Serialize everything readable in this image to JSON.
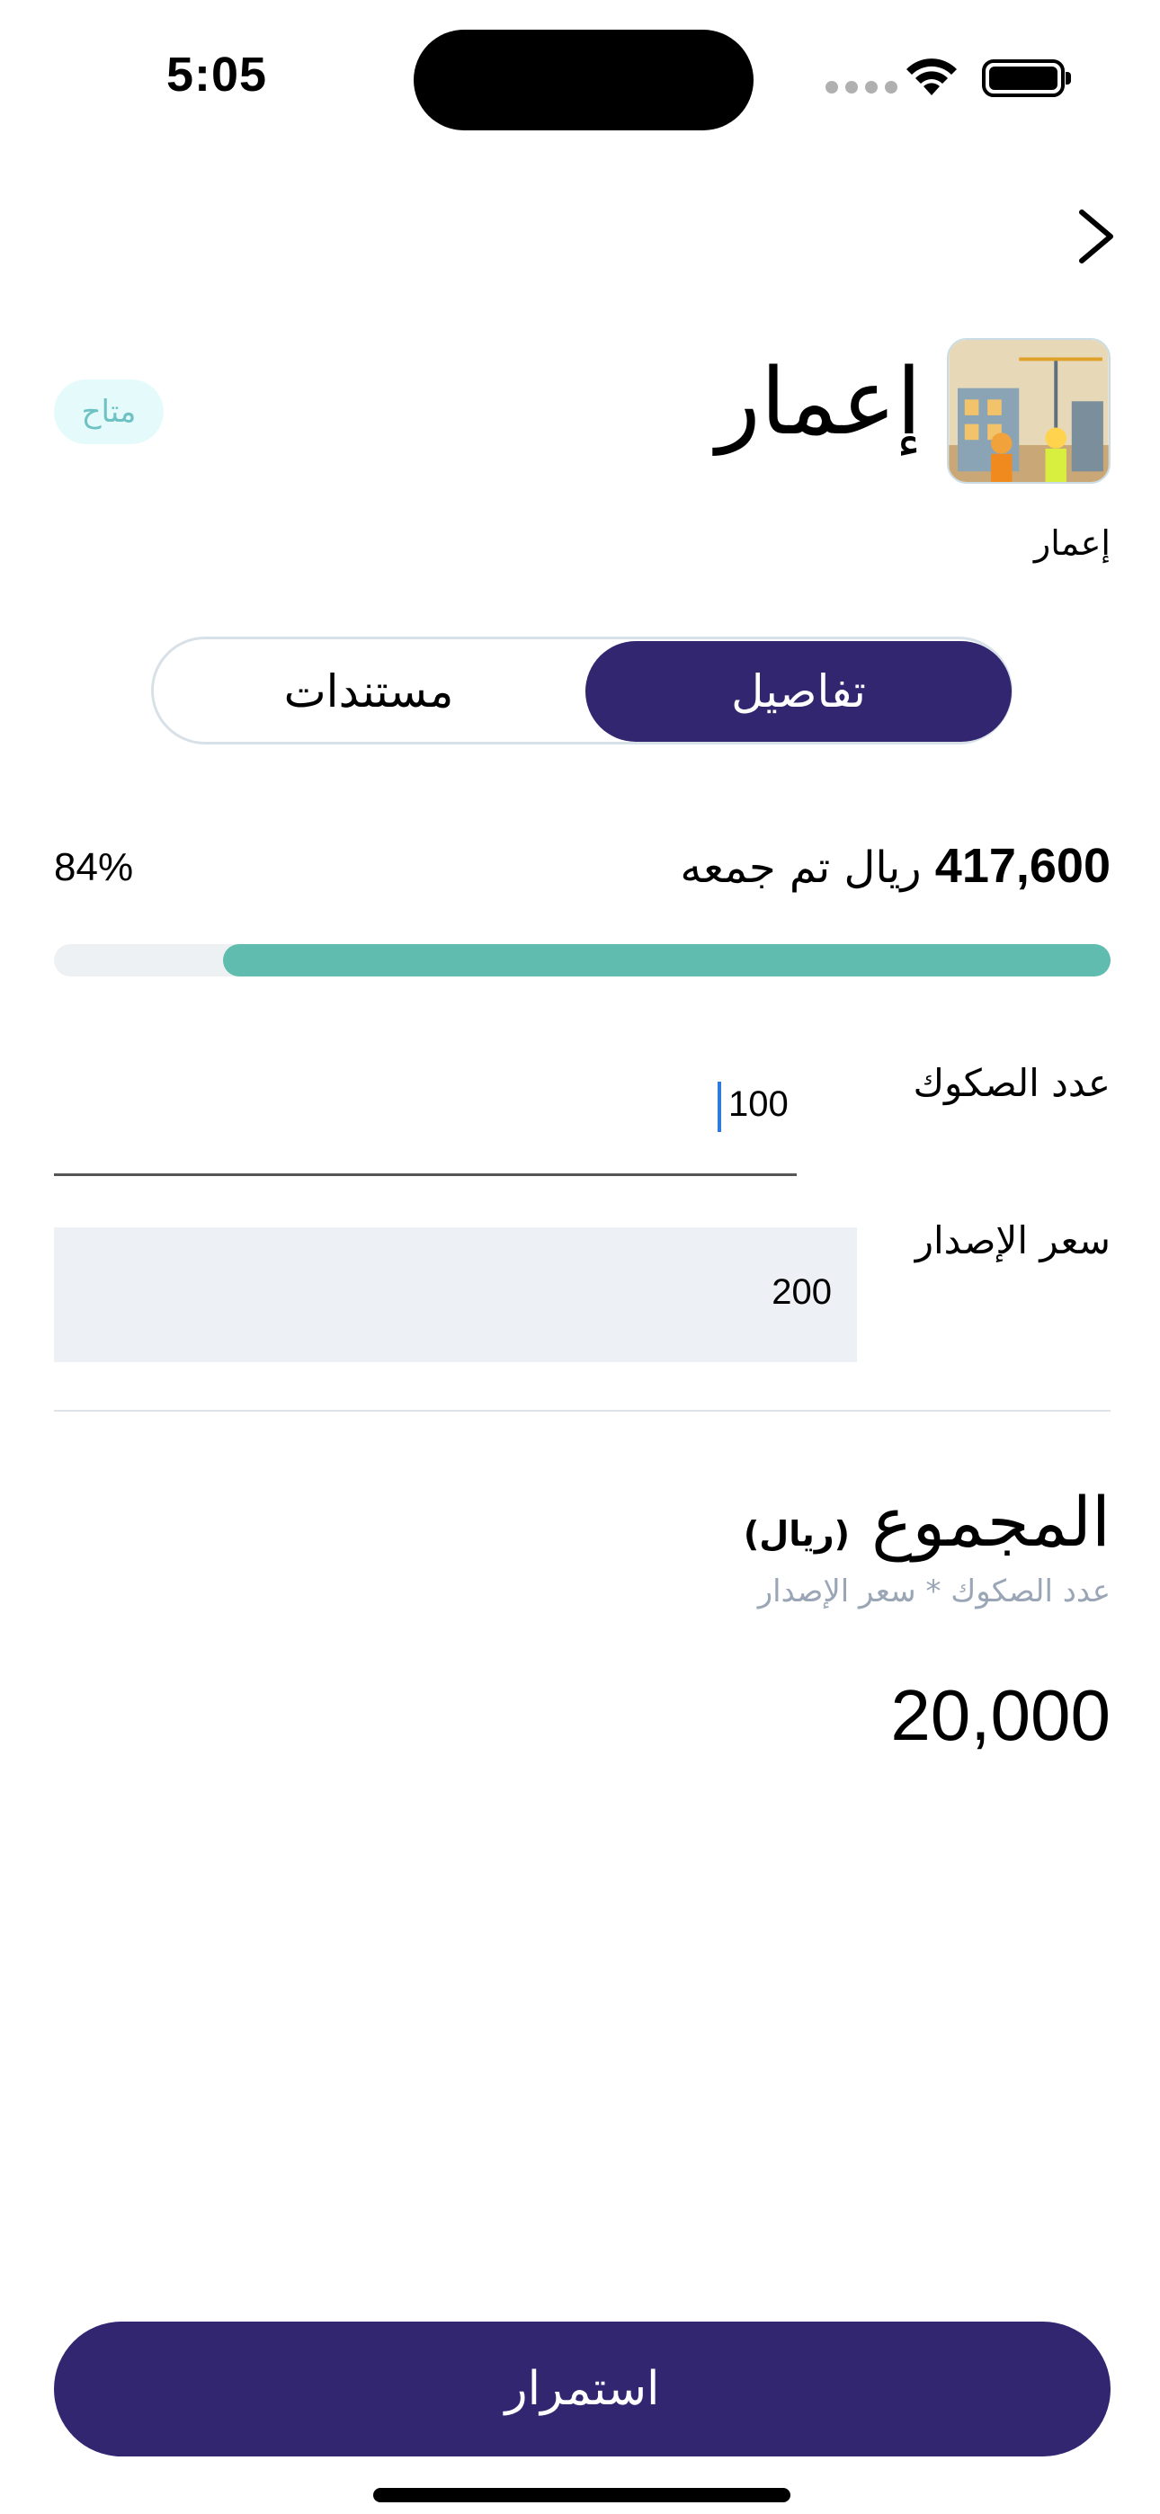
{
  "status_bar": {
    "time": "5:05"
  },
  "header": {
    "title": "إعمار",
    "status_badge": "متاح",
    "subtitle": "إعمار"
  },
  "tabs": {
    "active": "تفاصيل",
    "inactive": "مستندات"
  },
  "funding": {
    "amount": "417,600",
    "amount_suffix": "ريال تم جمعه",
    "percent_label": "84%",
    "progress": 0.84
  },
  "fields": {
    "quantity_label": "عدد الصكوك",
    "quantity_value": "100",
    "price_label": "سعر الإصدار",
    "price_value": "200"
  },
  "total": {
    "title": "المجموع",
    "unit": "(ريال)",
    "formula": "عدد الصكوك * سعر الإصدار",
    "value": "20,000"
  },
  "actions": {
    "continue_label": "استمرار"
  },
  "colors": {
    "primary": "#322671",
    "progress": "#5fbcaf",
    "badge_bg": "#e5fbfb",
    "badge_text": "#6fc2c4"
  },
  "icons": [
    "chevron-right-icon",
    "wifi-icon",
    "battery-icon",
    "project-thumbnail"
  ]
}
